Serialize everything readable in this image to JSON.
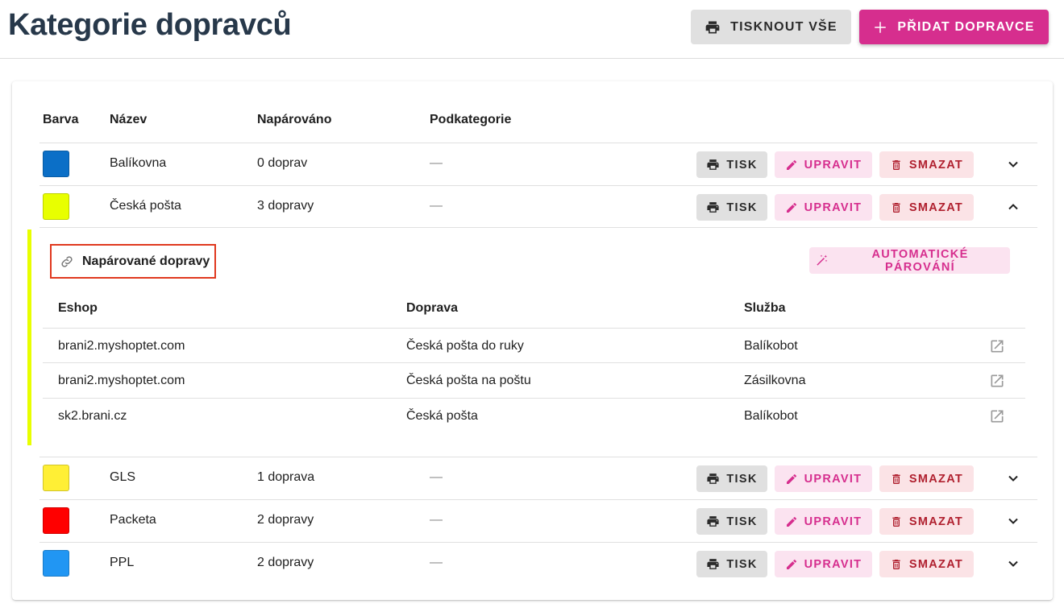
{
  "header": {
    "title": "Kategorie dopravců",
    "print_all_label": "TISKNOUT VŠE",
    "add_label": "PŘIDAT DOPRAVCE"
  },
  "table": {
    "headers": {
      "color": "Barva",
      "name": "Název",
      "paired": "Napárováno",
      "subcategory": "Podkategorie"
    },
    "actions": {
      "print": "TISK",
      "edit": "UPRAVIT",
      "delete": "SMAZAT"
    },
    "rows": [
      {
        "color": "#0b6fc7",
        "name": "Balíkovna",
        "paired": "0 doprav",
        "subcategory": "—",
        "expanded": false
      },
      {
        "color": "#e8ff00",
        "name": "Česká pošta",
        "paired": "3 dopravy",
        "subcategory": "—",
        "expanded": true
      },
      {
        "color": "#ffef35",
        "name": "GLS",
        "paired": "1 doprava",
        "subcategory": "—",
        "expanded": false
      },
      {
        "color": "#ff0000",
        "name": "Packeta",
        "paired": "2 dopravy",
        "subcategory": "—",
        "expanded": false
      },
      {
        "color": "#2196f3",
        "name": "PPL",
        "paired": "2 dopravy",
        "subcategory": "—",
        "expanded": false
      }
    ]
  },
  "expanded_panel": {
    "accent_color": "#e8ff00",
    "title": "Napárované dopravy",
    "auto_pair_label": "AUTOMATICKÉ PÁROVÁNÍ",
    "headers": {
      "eshop": "Eshop",
      "shipping": "Doprava",
      "service": "Služba"
    },
    "rows": [
      {
        "eshop": "brani2.myshoptet.com",
        "shipping": "Česká pošta do ruky",
        "service": "Balíkobot"
      },
      {
        "eshop": "brani2.myshoptet.com",
        "shipping": "Česká pošta na poštu",
        "service": "Zásilkovna"
      },
      {
        "eshop": "sk2.brani.cz",
        "shipping": "Česká pošta",
        "service": "Balíkobot"
      }
    ]
  },
  "icons": {
    "print": "printer-icon",
    "add": "plus-icon",
    "edit": "pencil-icon",
    "delete": "trash-icon",
    "expand": "chevron-down-icon",
    "collapse": "chevron-up-icon",
    "link": "link-icon",
    "auto": "magic-wand-icon",
    "external": "open-in-new-icon"
  },
  "colors": {
    "accent": "#d62e8e",
    "danger": "#b0202f",
    "title": "#27384a"
  }
}
